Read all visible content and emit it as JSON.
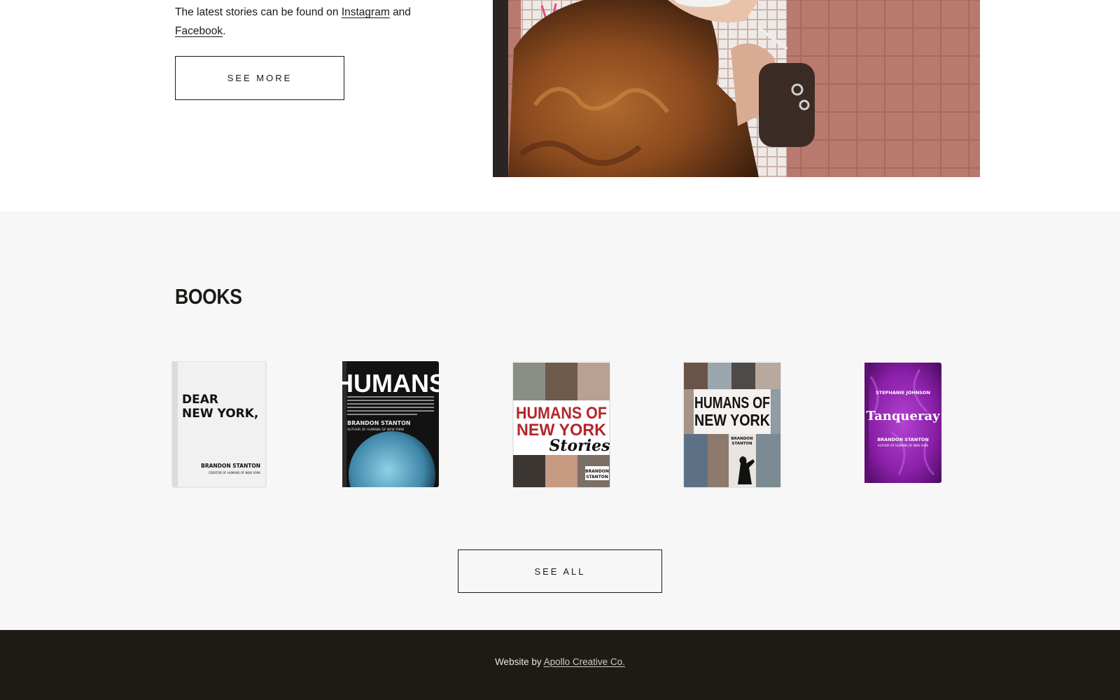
{
  "intro": {
    "line_prefix": "The latest stories can be found on",
    "instagram_link": "Instagram",
    "conjunction": "and",
    "facebook_link": "Facebook",
    "period": ".",
    "see_more_label": "SEE MORE"
  },
  "books": {
    "title": "BOOKS",
    "items": [
      {
        "title_line1": "DEAR",
        "title_line2": "NEW YORK,",
        "author": "BRANDON STANTON",
        "subtitle": "CREATOR OF HUMANS OF NEW YORK"
      },
      {
        "title": "HUMANS",
        "author": "BRANDON STANTON",
        "subtitle": "AUTHOR OF HUMANS OF NEW YORK"
      },
      {
        "title_line1": "HUMANS OF",
        "title_line2": "NEW YORK",
        "script": "Stories",
        "author_line1": "BRANDON",
        "author_line2": "STANTON"
      },
      {
        "title_line1": "HUMANS OF",
        "title_line2": "NEW YORK",
        "author_line1": "BRANDON",
        "author_line2": "STANTON"
      },
      {
        "author_top": "STEPHANIE JOHNSON",
        "title": "Tanqueray",
        "author": "BRANDON STANTON",
        "subtitle": "AUTHOR OF HUMANS OF NEW YORK"
      }
    ],
    "see_all_label": "SEE ALL"
  },
  "footer": {
    "prefix": "Website by",
    "link": "Apollo Creative Co."
  },
  "colors": {
    "text": "#1c1a17",
    "section_bg": "#f7f7f7",
    "footer_bg": "#1e1b17",
    "tanqueray_purple": "#8a1fa8",
    "stories_red": "#b3262b"
  }
}
